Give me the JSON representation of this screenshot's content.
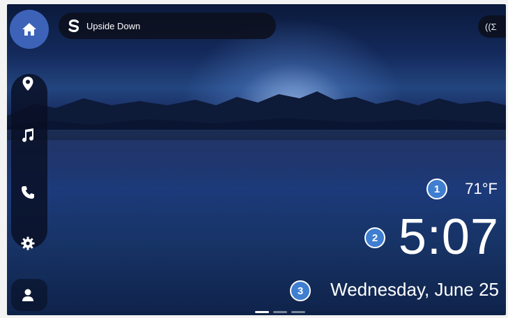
{
  "media": {
    "source_icon": "siriusxm-icon",
    "title": "Upside Down"
  },
  "top_right": {
    "icon": "wireless-signal-icon",
    "label": "((Σ"
  },
  "sidebar": {
    "items": [
      {
        "name": "home",
        "icon": "home-icon",
        "active": true
      },
      {
        "name": "navigation",
        "icon": "location-pin-icon"
      },
      {
        "name": "media",
        "icon": "music-note-icon"
      },
      {
        "name": "phone",
        "icon": "phone-icon"
      },
      {
        "name": "settings",
        "icon": "gear-icon"
      },
      {
        "name": "profile",
        "icon": "person-icon"
      }
    ]
  },
  "status": {
    "temperature": "71°F",
    "time": "5:07",
    "date": "Wednesday, June 25"
  },
  "callouts": [
    "1",
    "2",
    "3"
  ],
  "pager": {
    "pages": 3,
    "active_index": 0
  },
  "colors": {
    "accent": "#3c63b8",
    "callout": "#3f7ed0"
  }
}
